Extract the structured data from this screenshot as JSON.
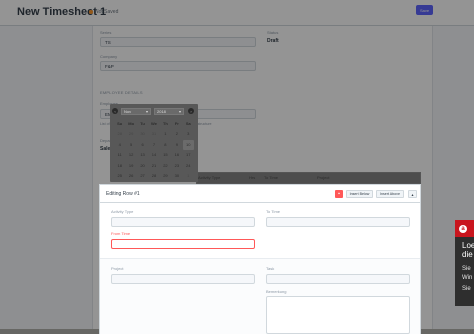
{
  "header": {
    "title": "New Timesheet 1",
    "status": "Not Saved",
    "save_label": "Save",
    "colors": {
      "primary": "#5e64ff",
      "status_dot": "#ff9a2e"
    }
  },
  "form": {
    "series_label": "Series",
    "series_value": "TS",
    "status_label": "Status",
    "status_value": "Draft",
    "company_label": "Company",
    "company_value": "F&P",
    "section_label": "EMPLOYEE DETAILS",
    "employee_label": "Employee",
    "employee_value": "EM",
    "note": "List of employees ... \"Weekly Timesheet\" is enabled in salary structure",
    "dept_label": "Department",
    "dept_value": "Sales"
  },
  "datepicker": {
    "month": "Nov",
    "year": "2018",
    "days_of_week": [
      "Su",
      "Mo",
      "Tu",
      "We",
      "Th",
      "Fr",
      "Sa"
    ],
    "weeks": [
      [
        "28",
        "29",
        "30",
        "31",
        "1",
        "2",
        "3"
      ],
      [
        "4",
        "5",
        "6",
        "7",
        "8",
        "9",
        "10"
      ],
      [
        "11",
        "12",
        "13",
        "14",
        "15",
        "16",
        "17"
      ],
      [
        "18",
        "19",
        "20",
        "21",
        "22",
        "23",
        "24"
      ],
      [
        "25",
        "26",
        "27",
        "28",
        "29",
        "30",
        "1"
      ],
      [
        "2",
        "3",
        "4",
        "5",
        "6",
        "7",
        "8"
      ]
    ]
  },
  "table": {
    "headers": [
      "Activity Type",
      "Hrs",
      "To Time",
      "Project"
    ]
  },
  "modal": {
    "title": "Editing Row #1",
    "insert_below": "Insert Below",
    "insert_above": "Insert Above",
    "fields": {
      "activity_type": "Activity Type",
      "to_time": "To Time",
      "from_time": "From Time",
      "project": "Project",
      "task": "Task",
      "comment": "Bemerkung"
    }
  },
  "popup": {
    "heading": "Loe die",
    "line1": "Sie",
    "line2": "Win",
    "line3": "Sie"
  }
}
